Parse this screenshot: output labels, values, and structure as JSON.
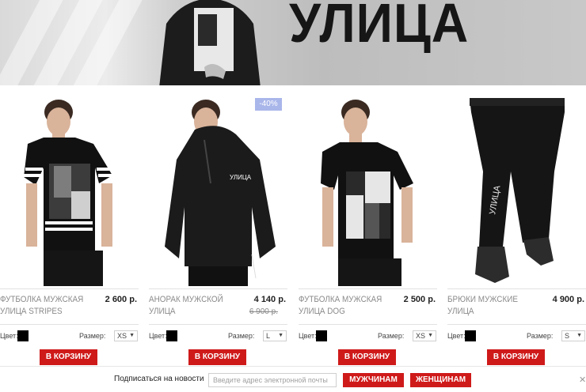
{
  "banner": {
    "title": "УЛИЦА"
  },
  "products": [
    {
      "name": "Футболка мужская Улица Stripes",
      "price": "2 600 р.",
      "old_price": "",
      "badge": "",
      "color_label": "Цвет:",
      "size_label": "Размер:",
      "size": "XS",
      "cart_label": "В корзину"
    },
    {
      "name": "Анорак мужской Улица",
      "price": "4 140 р.",
      "old_price": "6 900 р.",
      "badge": "-40%",
      "color_label": "Цвет:",
      "size_label": "Размер:",
      "size": "L",
      "cart_label": "В корзину"
    },
    {
      "name": "Футболка мужская Улица DOG",
      "price": "2 500 р.",
      "old_price": "",
      "badge": "",
      "color_label": "Цвет:",
      "size_label": "Размер:",
      "size": "XS",
      "cart_label": "В корзину"
    },
    {
      "name": "Брюки мужские Улица",
      "price": "4 900 р.",
      "old_price": "",
      "badge": "",
      "color_label": "Цвет:",
      "size_label": "Размер:",
      "size": "S",
      "cart_label": "В корзину"
    }
  ],
  "newsletter": {
    "label": "Подписаться на новости",
    "placeholder": "Введите адрес электронной почты",
    "men_label": "МУЖЧИНАМ",
    "women_label": "ЖЕНЩИНАМ",
    "close": "✕"
  },
  "colors": {
    "accent": "#cf1a1a",
    "badge": "#a9b6ea",
    "swatch": "#000000"
  },
  "icons": [
    "close-icon",
    "chevron-down-icon"
  ]
}
